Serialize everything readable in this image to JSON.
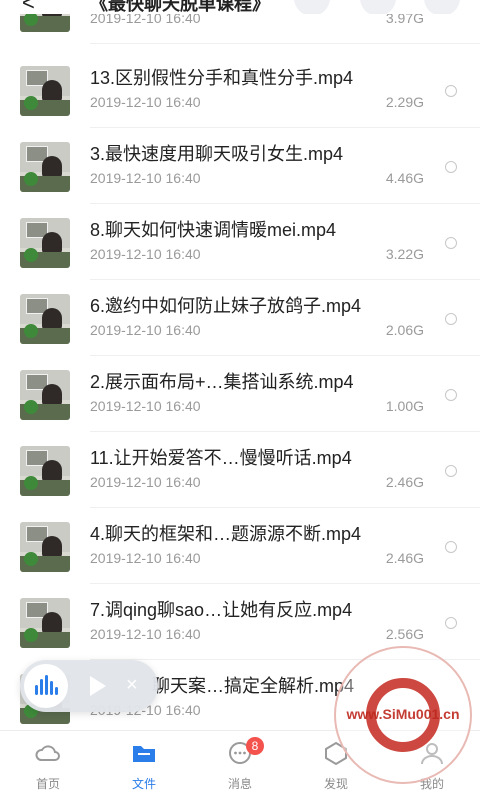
{
  "header": {
    "back_label": "<",
    "title": "《最快聊天脱单课程》"
  },
  "files": [
    {
      "name": "",
      "date": "2019-12-10 16:40",
      "size": "3.97G"
    },
    {
      "name": "13.区别假性分手和真性分手.mp4",
      "date": "2019-12-10 16:40",
      "size": "2.29G"
    },
    {
      "name": "3.最快速度用聊天吸引女生.mp4",
      "date": "2019-12-10 16:40",
      "size": "4.46G"
    },
    {
      "name": "8.聊天如何快速调情暖mei.mp4",
      "date": "2019-12-10 16:40",
      "size": "3.22G"
    },
    {
      "name": "6.邀约中如何防止妹子放鸽子.mp4",
      "date": "2019-12-10 16:40",
      "size": "2.06G"
    },
    {
      "name": "2.展示面布局+…集搭讪系统.mp4",
      "date": "2019-12-10 16:40",
      "size": "1.00G"
    },
    {
      "name": "11.让开始爱答不…慢慢听话.mp4",
      "date": "2019-12-10 16:40",
      "size": "2.46G"
    },
    {
      "name": "4.聊天的框架和…题源源不断.mp4",
      "date": "2019-12-10 16:40",
      "size": "2.46G"
    },
    {
      "name": "7.调qing聊sao…让她有反应.mp4",
      "date": "2019-12-10 16:40",
      "size": "2.56G"
    },
    {
      "name": "聊天案…搞定全解析.mp4",
      "date": "2019-12-10 16:40",
      "size": ""
    }
  ],
  "player": {
    "close_label": "×"
  },
  "tabbar": {
    "tabs": [
      {
        "label": "首页"
      },
      {
        "label": "文件"
      },
      {
        "label": "消息",
        "badge": "8"
      },
      {
        "label": "发现"
      },
      {
        "label": "我的"
      }
    ]
  },
  "watermark": {
    "text": "www.SiMu001.cn"
  },
  "colors": {
    "accent": "#2b7de9",
    "badge": "#f4524d",
    "text_secondary": "#9a9a9a"
  }
}
